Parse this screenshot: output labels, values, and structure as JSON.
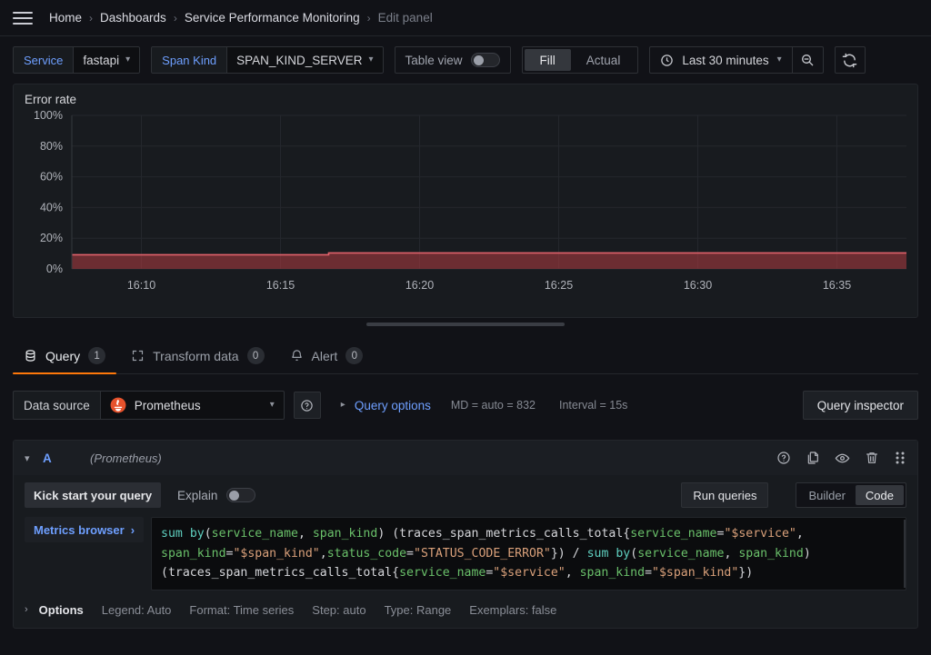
{
  "breadcrumb": {
    "menu_icon": "hamburger-icon",
    "items": [
      {
        "label": "Home",
        "active": false
      },
      {
        "label": "Dashboards",
        "active": false
      },
      {
        "label": "Service Performance Monitoring",
        "active": false
      },
      {
        "label": "Edit panel",
        "active": true
      }
    ],
    "separator": "›"
  },
  "controls": {
    "service_var": {
      "label": "Service",
      "value": "fastapi"
    },
    "span_kind_var": {
      "label": "Span Kind",
      "value": "SPAN_KIND_SERVER"
    },
    "table_view": {
      "label": "Table view",
      "enabled": false
    },
    "fill_actual": {
      "options": [
        "Fill",
        "Actual"
      ],
      "selected": "Fill"
    },
    "time_picker": {
      "value": "Last 30 minutes",
      "icon": "clock-icon"
    },
    "zoom_out": {
      "icon": "zoom-out-icon"
    },
    "refresh": {
      "icon": "refresh-icon"
    }
  },
  "panel": {
    "title": "Error rate"
  },
  "chart_data": {
    "type": "area",
    "title": "Error rate",
    "xlabel": "",
    "ylabel": "",
    "ylim": [
      0,
      100
    ],
    "ytick_labels": [
      "0%",
      "20%",
      "40%",
      "60%",
      "80%",
      "100%"
    ],
    "ytick_values": [
      0,
      20,
      40,
      60,
      80,
      100
    ],
    "xtick_labels": [
      "16:10",
      "16:15",
      "16:20",
      "16:25",
      "16:30",
      "16:35"
    ],
    "grid": true,
    "legend": "none",
    "series": [
      {
        "name": "error rate",
        "color": "#e0626b",
        "fill_color": "rgba(178,60,66,0.55)",
        "x": [
          "16:08",
          "16:10",
          "16:12",
          "16:14",
          "16:15",
          "16:17",
          "16:20",
          "16:23",
          "16:25",
          "16:28",
          "16:30",
          "16:33",
          "16:35",
          "16:38"
        ],
        "values": [
          9.2,
          9.2,
          9.2,
          9.2,
          10.4,
          10.4,
          10.4,
          10.4,
          10.4,
          10.4,
          10.4,
          10.4,
          10.4,
          10.4
        ]
      }
    ]
  },
  "tabs": [
    {
      "label": "Query",
      "badge": "1",
      "icon": "database-icon",
      "active": true
    },
    {
      "label": "Transform data",
      "badge": "0",
      "icon": "transform-icon",
      "active": false
    },
    {
      "label": "Alert",
      "badge": "0",
      "icon": "bell-icon",
      "active": false
    }
  ],
  "datasource_row": {
    "label": "Data source",
    "value": "Prometheus",
    "logo": "prometheus-icon",
    "help_icon": "help-circle-icon",
    "query_options_link": "Query options",
    "max_data_points": "MD = auto = 832",
    "interval": "Interval = 15s",
    "query_inspector": "Query inspector"
  },
  "query": {
    "ref_id": "A",
    "datasource_note": "(Prometheus)",
    "actions": [
      {
        "name": "help-circle-icon"
      },
      {
        "name": "duplicate-icon"
      },
      {
        "name": "eye-icon"
      },
      {
        "name": "trash-icon"
      },
      {
        "name": "drag-handle-icon"
      }
    ],
    "kick_start": "Kick start your query",
    "explain_label": "Explain",
    "explain_enabled": false,
    "run_queries": "Run queries",
    "mode_options": [
      "Builder",
      "Code"
    ],
    "mode_selected": "Code",
    "metrics_browser": "Metrics browser",
    "metrics_browser_chevron": "›",
    "expr_tokens": [
      {
        "t": "sum",
        "c": "kw"
      },
      {
        "t": " ",
        "c": "plain"
      },
      {
        "t": "by",
        "c": "kw"
      },
      {
        "t": "(",
        "c": "plain"
      },
      {
        "t": "service_name",
        "c": "lbl"
      },
      {
        "t": ", ",
        "c": "plain"
      },
      {
        "t": "span_kind",
        "c": "lbl"
      },
      {
        "t": ") (traces_span_metrics_calls_total{",
        "c": "plain"
      },
      {
        "t": "service_name",
        "c": "lbl"
      },
      {
        "t": "=",
        "c": "plain"
      },
      {
        "t": "\"$service\"",
        "c": "str"
      },
      {
        "t": ",\n",
        "c": "plain"
      },
      {
        "t": "span_kind",
        "c": "lbl"
      },
      {
        "t": "=",
        "c": "plain"
      },
      {
        "t": "\"$span_kind\"",
        "c": "str"
      },
      {
        "t": ",",
        "c": "plain"
      },
      {
        "t": "status_code",
        "c": "lbl"
      },
      {
        "t": "=",
        "c": "plain"
      },
      {
        "t": "\"STATUS_CODE_ERROR\"",
        "c": "str"
      },
      {
        "t": "}) / ",
        "c": "plain"
      },
      {
        "t": "sum",
        "c": "kw"
      },
      {
        "t": " ",
        "c": "plain"
      },
      {
        "t": "by",
        "c": "kw"
      },
      {
        "t": "(",
        "c": "plain"
      },
      {
        "t": "service_name",
        "c": "lbl"
      },
      {
        "t": ", ",
        "c": "plain"
      },
      {
        "t": "span_kind",
        "c": "lbl"
      },
      {
        "t": ")\n(traces_span_metrics_calls_total{",
        "c": "plain"
      },
      {
        "t": "service_name",
        "c": "lbl"
      },
      {
        "t": "=",
        "c": "plain"
      },
      {
        "t": "\"$service\"",
        "c": "str"
      },
      {
        "t": ", ",
        "c": "plain"
      },
      {
        "t": "span_kind",
        "c": "lbl"
      },
      {
        "t": "=",
        "c": "plain"
      },
      {
        "t": "\"$span_kind\"",
        "c": "str"
      },
      {
        "t": "})",
        "c": "plain"
      }
    ],
    "options_row": {
      "chevron": "›",
      "title": "Options",
      "items": [
        "Legend: Auto",
        "Format: Time series",
        "Step: auto",
        "Type: Range",
        "Exemplars: false"
      ]
    }
  }
}
